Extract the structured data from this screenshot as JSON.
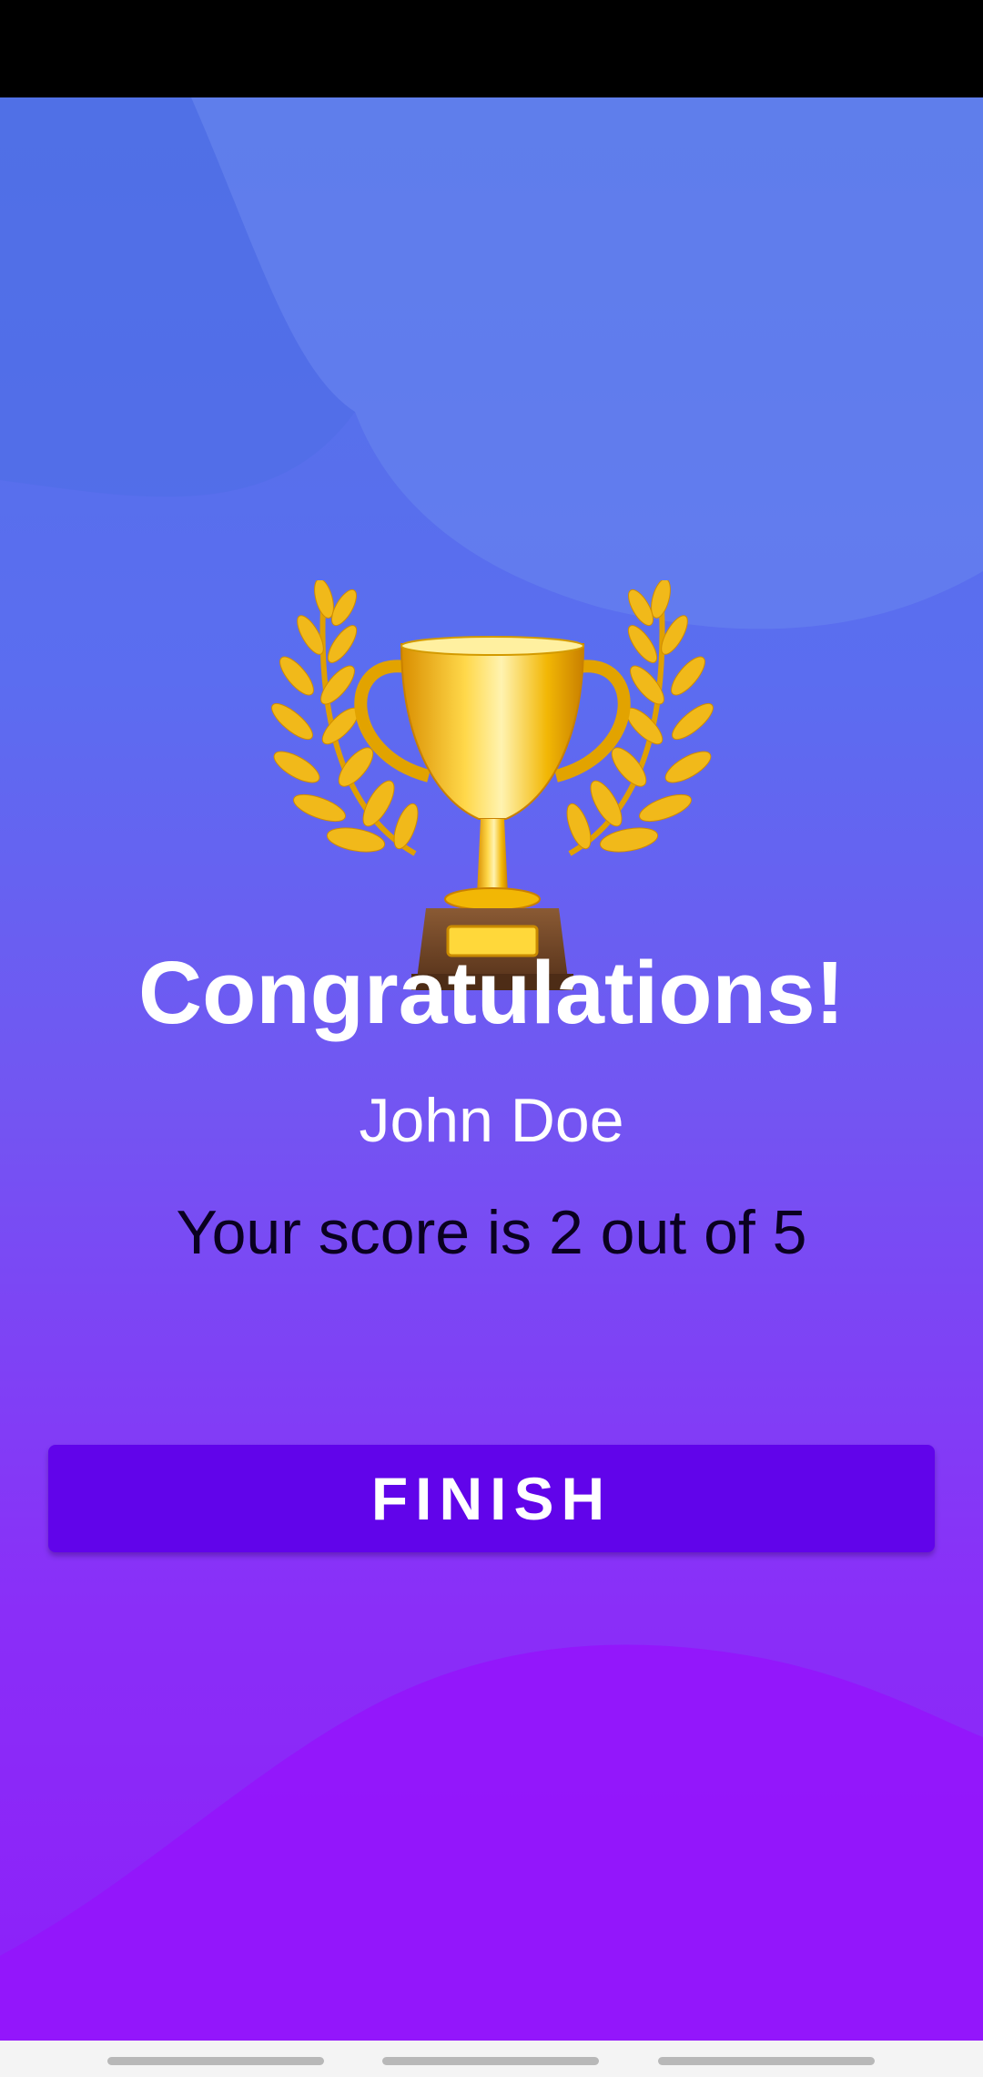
{
  "screen": {
    "title": "Congratulations!",
    "player_name": "John Doe",
    "score_text": "Your score is 2 out of 5",
    "finish_label": "FINISH",
    "trophy_icon": "trophy-icon"
  },
  "colors": {
    "background_top": "#5273e6",
    "background_bottom": "#8d1ff9",
    "button": "#6104ea",
    "title_text": "#ffffff",
    "score_text": "#0a0020",
    "trophy_gold": "#f2b705",
    "trophy_base": "#7a4b2a"
  }
}
